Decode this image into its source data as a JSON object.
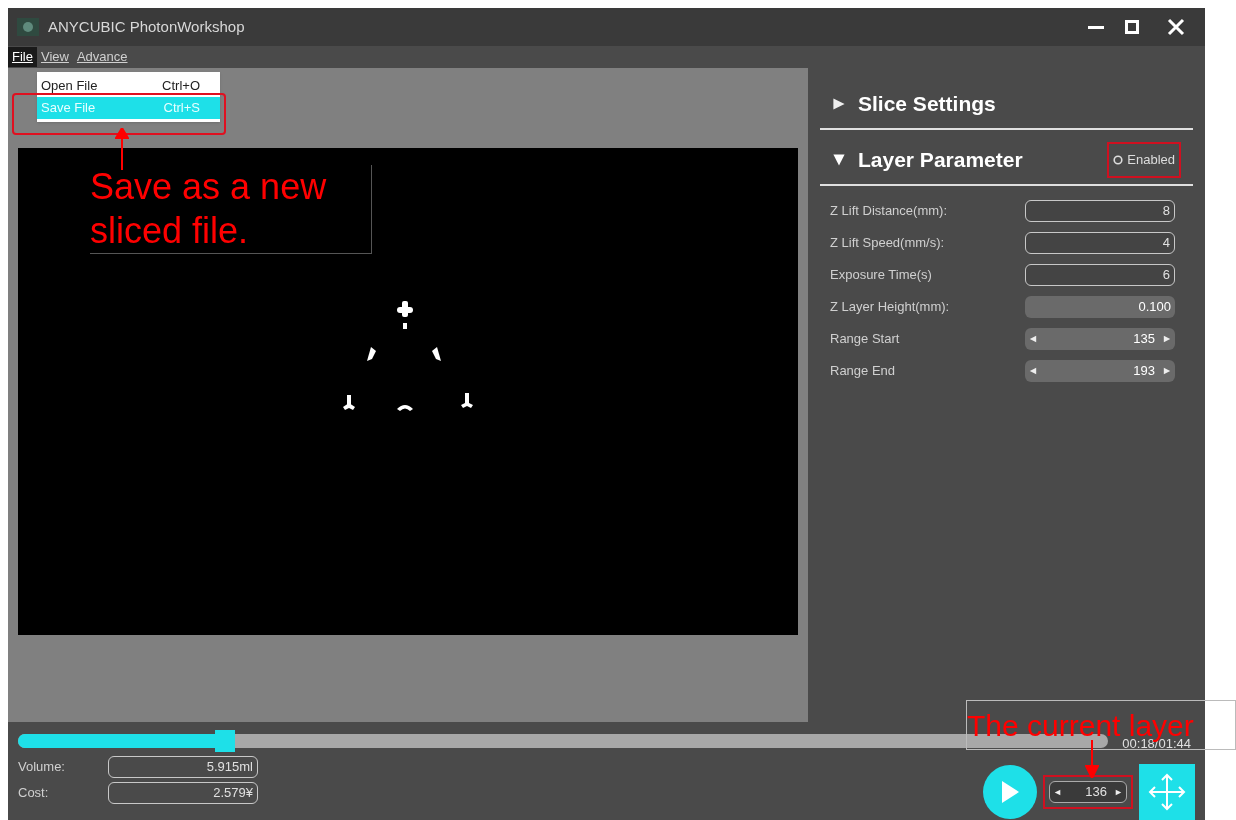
{
  "window": {
    "title": "ANYCUBIC PhotonWorkshop"
  },
  "menu_bar": [
    {
      "label": "File",
      "selected": true
    },
    {
      "label": "View",
      "selected": false
    },
    {
      "label": "Advance",
      "selected": false
    }
  ],
  "file_menu": [
    {
      "label": "Open File",
      "shortcut": "Ctrl+O",
      "selected": false
    },
    {
      "label": "Save File",
      "shortcut": "Ctrl+S",
      "selected": true
    }
  ],
  "sections": [
    {
      "title": "Slice Settings",
      "expanded": false
    },
    {
      "title": "Layer Parameter",
      "expanded": true
    }
  ],
  "enabled_toggle": {
    "label": "Enabled",
    "on": false
  },
  "parameters": [
    {
      "label": "Z Lift Distance(mm):",
      "value": "8",
      "kind": "field"
    },
    {
      "label": "Z Lift Speed(mm/s):",
      "value": "4",
      "kind": "field"
    },
    {
      "label": "Exposure Time(s)",
      "value": "6",
      "kind": "field"
    },
    {
      "label": "Z Layer Height(mm):",
      "value": "0.100",
      "kind": "readonly"
    },
    {
      "label": "Range Start",
      "value": "135",
      "kind": "spinner"
    },
    {
      "label": "Range End",
      "value": "193",
      "kind": "spinner"
    }
  ],
  "timeline": {
    "level": 0.19,
    "time": "00:18/01:44"
  },
  "stats": [
    {
      "label": "Volume:",
      "value": "5.915ml"
    },
    {
      "label": "Cost:",
      "value": "2.579¥"
    }
  ],
  "current_layer": "136",
  "annotations": [
    {
      "text": "Save as a new sliced file."
    },
    {
      "text": "The current layer"
    }
  ]
}
